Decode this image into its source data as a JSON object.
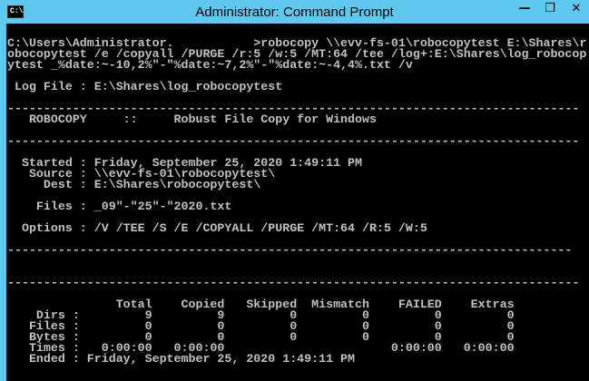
{
  "window": {
    "title": "Administrator: Command Prompt",
    "icon_label": "C:\\",
    "minimize": "—",
    "maximize": "❐",
    "close": "✕"
  },
  "console": {
    "lines": [
      "C:\\Users\\Administrator.           >robocopy \\\\evv-fs-01\\robocopytest E:\\Shares\\r",
      "obocopytest /e /copyall /PURGE /r:5 /w:5 /MT:64 /tee /log+:E:\\Shares\\log_robocop",
      "ytest _%date:~-10,2%\"-\"%date:~7,2%\"-\"%date:~-4,4%.txt /v",
      "",
      " Log File : E:\\Shares\\log_robocopytest",
      "",
      "-------------------------------------------------------------------------------",
      "   ROBOCOPY     ::     Robust File Copy for Windows",
      "",
      "-------------------------------------------------------------------------------",
      "",
      "  Started : Friday, September 25, 2020 1:49:11 PM",
      "   Source : \\\\evv-fs-01\\robocopytest\\",
      "     Dest : E:\\Shares\\robocopytest\\",
      "",
      "    Files : _09\"-\"25\"-\"2020.txt",
      "",
      "  Options : /V /TEE /S /E /COPYALL /PURGE /MT:64 /R:5 /W:5",
      "",
      "------------------------------------------------------------------------------",
      "",
      "",
      "-------------------------------------------------------------------------------",
      "",
      "               Total    Copied   Skipped  Mismatch    FAILED    Extras",
      "    Dirs :         9         9         0         0         0         0",
      "   Files :         0         0         0         0         0         0",
      "   Bytes :         0         0         0         0         0         0",
      "   Times :   0:00:00   0:00:00                       0:00:00   0:00:00",
      "   Ended : Friday, September 25, 2020 1:49:11 PM"
    ]
  }
}
